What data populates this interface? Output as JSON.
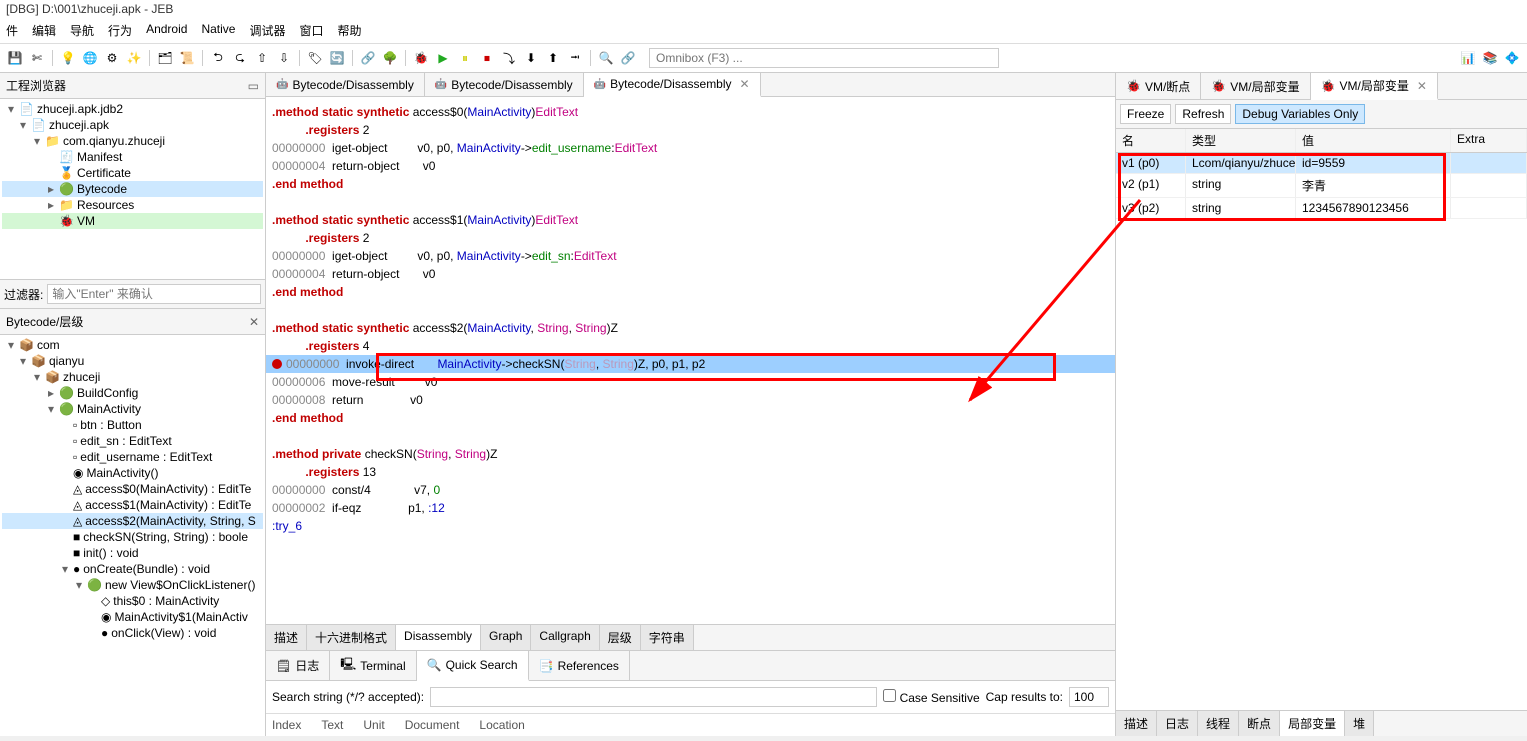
{
  "window_title": "[DBG] D:\\001\\zhuceji.apk - JEB",
  "menu": [
    "件",
    "编辑",
    "导航",
    "行为",
    "Android",
    "Native",
    "调试器",
    "窗口",
    "帮助"
  ],
  "omnibox_placeholder": "Omnibox (F3) ...",
  "left": {
    "project_explorer_title": "工程浏览器",
    "filter_label": "过滤器:",
    "filter_placeholder": "输入\"Enter\" 来确认",
    "hierarchy_title": "Bytecode/层级",
    "tree1": [
      {
        "label": "zhuceji.apk.jdb2",
        "indent": 0,
        "expand": "▾",
        "icon": "📄"
      },
      {
        "label": "zhuceji.apk",
        "indent": 1,
        "expand": "▾",
        "icon": "📄"
      },
      {
        "label": "com.qianyu.zhuceji",
        "indent": 2,
        "expand": "▾",
        "icon": "📁"
      },
      {
        "label": "Manifest",
        "indent": 3,
        "expand": "",
        "icon": "🧾"
      },
      {
        "label": "Certificate",
        "indent": 3,
        "expand": "",
        "icon": "🏅"
      },
      {
        "label": "Bytecode",
        "indent": 3,
        "expand": "▸",
        "icon": "🟢",
        "sel": true
      },
      {
        "label": "Resources",
        "indent": 3,
        "expand": "▸",
        "icon": "📁"
      },
      {
        "label": "VM",
        "indent": 3,
        "expand": "",
        "icon": "🐞",
        "hl": true
      }
    ],
    "tree2": [
      {
        "label": "com",
        "indent": 0,
        "expand": "▾",
        "icon": "📦"
      },
      {
        "label": "qianyu",
        "indent": 1,
        "expand": "▾",
        "icon": "📦"
      },
      {
        "label": "zhuceji",
        "indent": 2,
        "expand": "▾",
        "icon": "📦"
      },
      {
        "label": "BuildConfig",
        "indent": 3,
        "expand": "▸",
        "icon": "🟢"
      },
      {
        "label": "MainActivity",
        "indent": 3,
        "expand": "▾",
        "icon": "🟢"
      },
      {
        "label": "btn : Button",
        "indent": 4,
        "expand": "",
        "icon": "▫"
      },
      {
        "label": "edit_sn : EditText",
        "indent": 4,
        "expand": "",
        "icon": "▫"
      },
      {
        "label": "edit_username : EditText",
        "indent": 4,
        "expand": "",
        "icon": "▫"
      },
      {
        "label": "MainActivity()",
        "indent": 4,
        "expand": "",
        "icon": "◉"
      },
      {
        "label": "access$0(MainActivity) : EditTe",
        "indent": 4,
        "expand": "",
        "icon": "◬"
      },
      {
        "label": "access$1(MainActivity) : EditTe",
        "indent": 4,
        "expand": "",
        "icon": "◬"
      },
      {
        "label": "access$2(MainActivity, String, S",
        "indent": 4,
        "expand": "",
        "icon": "◬",
        "sel": true
      },
      {
        "label": "checkSN(String, String) : boole",
        "indent": 4,
        "expand": "",
        "icon": "■"
      },
      {
        "label": "init() : void",
        "indent": 4,
        "expand": "",
        "icon": "■"
      },
      {
        "label": "onCreate(Bundle) : void",
        "indent": 4,
        "expand": "▾",
        "icon": "●"
      },
      {
        "label": "new View$OnClickListener()",
        "indent": 5,
        "expand": "▾",
        "icon": "🟢"
      },
      {
        "label": "this$0 : MainActivity",
        "indent": 6,
        "expand": "",
        "icon": "◇"
      },
      {
        "label": "MainActivity$1(MainActiv",
        "indent": 6,
        "expand": "",
        "icon": "◉"
      },
      {
        "label": "onClick(View) : void",
        "indent": 6,
        "expand": "",
        "icon": "●"
      }
    ]
  },
  "center": {
    "tabs": [
      {
        "label": "Bytecode/Disassembly",
        "active": false
      },
      {
        "label": "Bytecode/Disassembly",
        "active": false
      },
      {
        "label": "Bytecode/Disassembly",
        "active": true,
        "closable": true
      }
    ],
    "bottom_tabs": [
      "描述",
      "十六进制格式",
      "Disassembly",
      "Graph",
      "Callgraph",
      "层级",
      "字符串"
    ],
    "bottom_tabs_active": 2
  },
  "output": {
    "tabs": [
      "日志",
      "Terminal",
      "Quick Search",
      "References"
    ],
    "active_tab": 2,
    "search_label": "Search string (*/? accepted):",
    "case_sensitive_label": "Case Sensitive",
    "cap_label": "Cap results to:",
    "cap_value": "100",
    "result_headers": [
      "Index",
      "Text",
      "Unit",
      "Document",
      "Location"
    ]
  },
  "right": {
    "tabs": [
      {
        "label": "VM/断点"
      },
      {
        "label": "VM/局部变量"
      },
      {
        "label": "VM/局部变量",
        "closable": true,
        "active": true
      }
    ],
    "freeze": "Freeze",
    "refresh": "Refresh",
    "debug_only": "Debug Variables Only",
    "headers": [
      "名",
      "类型",
      "值",
      "Extra"
    ],
    "rows": [
      {
        "name": "v1 (p0)",
        "type": "Lcom/qianyu/zhuce",
        "value": "id=9559",
        "sel": true
      },
      {
        "name": "v2 (p1)",
        "type": "string",
        "value": "李青"
      },
      {
        "name": "v3 (p2)",
        "type": "string",
        "value": "1234567890123456"
      }
    ],
    "bottom_tabs": [
      "描述",
      "日志",
      "线程",
      "断点",
      "局部变量",
      "堆"
    ],
    "bottom_tabs_active": 4
  }
}
